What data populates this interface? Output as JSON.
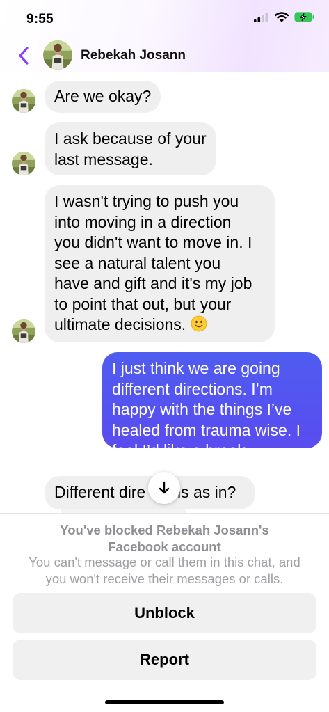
{
  "status_bar": {
    "time": "9:55"
  },
  "header": {
    "contact_name": "Rebekah Josann"
  },
  "messages": {
    "m1": {
      "lines": [
        "Are we okay?"
      ]
    },
    "m2": {
      "lines": [
        "I ask because of your",
        "last message."
      ]
    },
    "m3": {
      "lines": [
        "I wasn't trying to push you",
        "into moving in a direction",
        "you didn't want to move in. I",
        "see a natural talent you",
        "have and gift and it's my job",
        "to point that out, but your",
        "ultimate decisions."
      ]
    },
    "m4": {
      "lines": [
        "I just think we are going",
        "different directions. I’m",
        "happy with the things I’ve",
        "healed from trauma wise. I",
        "feel I’d like a break."
      ]
    },
    "m5": {
      "text_left": "Different dire",
      "text_right": "ns as in?"
    }
  },
  "blocked_notice": {
    "title_line1": "You've blocked Rebekah Josann's",
    "title_line2": "Facebook account",
    "desc_line1": "You can't message or call them in this chat, and",
    "desc_line2": "you won't receive their messages or calls."
  },
  "actions": {
    "unblock_label": "Unblock",
    "report_label": "Report"
  },
  "colors": {
    "accent": "#7b3ff2",
    "outgoing_bubble": "#5356f0",
    "incoming_bubble": "#efefef"
  }
}
